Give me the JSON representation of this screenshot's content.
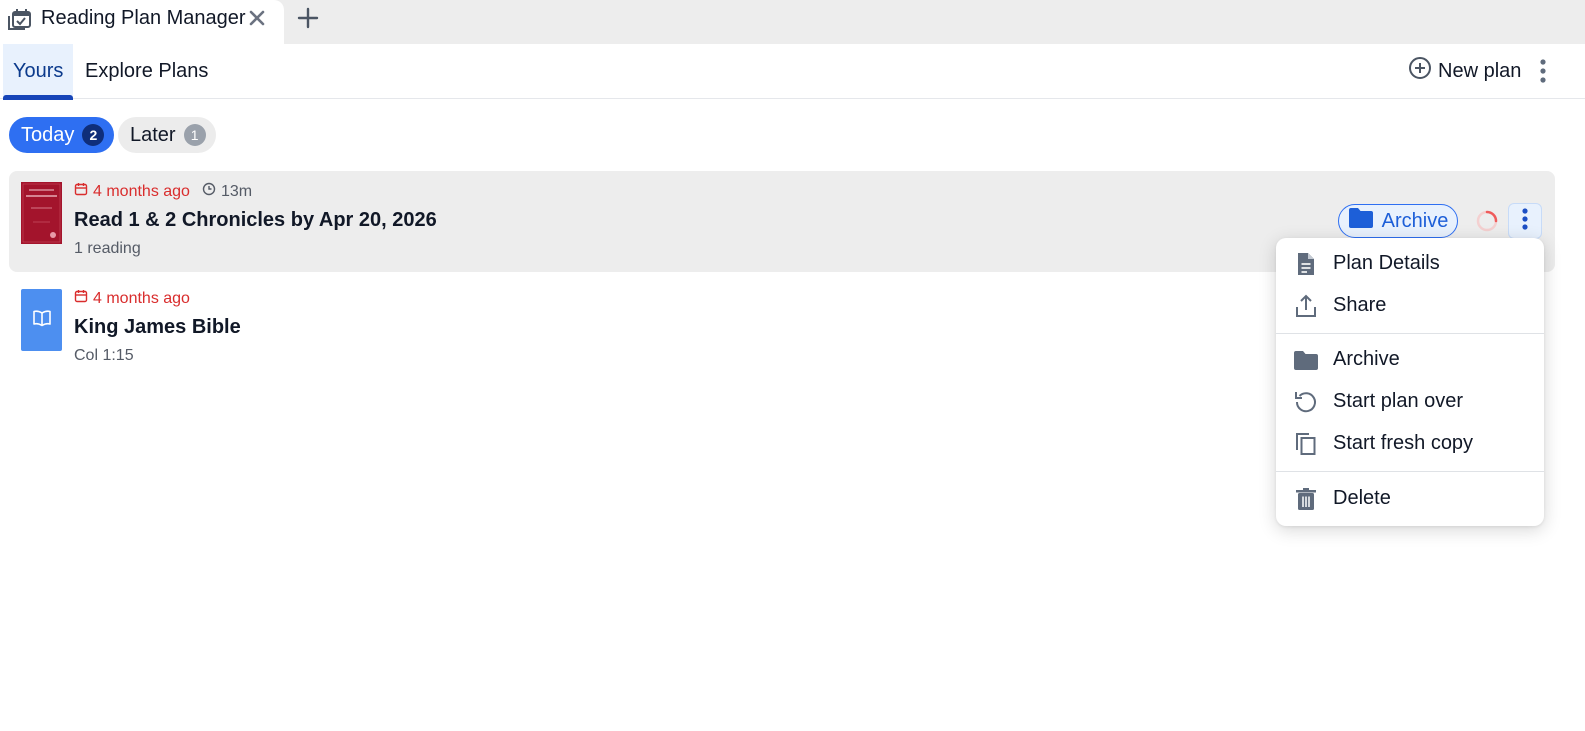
{
  "tab": {
    "title": "Reading Plan Manager"
  },
  "nav": {
    "tabs": [
      {
        "label": "Yours",
        "active": true
      },
      {
        "label": "Explore Plans",
        "active": false
      }
    ],
    "new_plan_label": "New plan"
  },
  "filters": [
    {
      "label": "Today",
      "count": "2",
      "active": true
    },
    {
      "label": "Later",
      "count": "1",
      "active": false
    }
  ],
  "plans": [
    {
      "cover": "chronicles-cover",
      "due": "4 months ago",
      "duration": "13m",
      "title": "Read 1 & 2 Chronicles by Apr 20, 2026",
      "subtitle": "1 reading",
      "archive_label": "Archive"
    },
    {
      "cover": "book-icon",
      "due": "4 months ago",
      "title": "King James Bible",
      "subtitle": "Col 1:15"
    }
  ],
  "context_menu": {
    "groups": [
      [
        {
          "label": "Plan Details",
          "icon": "document-icon"
        },
        {
          "label": "Share",
          "icon": "share-icon"
        }
      ],
      [
        {
          "label": "Archive",
          "icon": "folder-icon"
        },
        {
          "label": "Start plan over",
          "icon": "restart-icon"
        },
        {
          "label": "Start fresh copy",
          "icon": "copy-icon"
        }
      ],
      [
        {
          "label": "Delete",
          "icon": "trash-icon"
        }
      ]
    ]
  },
  "colors": {
    "accent": "#2e6ff2",
    "overdue": "#d92d2d",
    "icon_gray": "#5f6b7c"
  }
}
